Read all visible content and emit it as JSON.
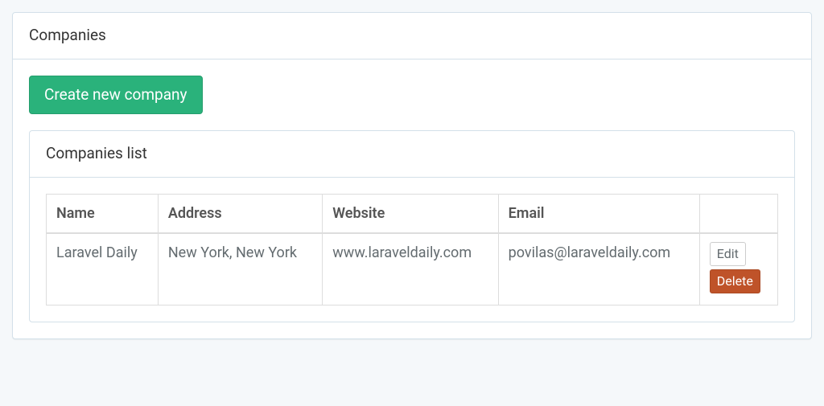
{
  "page": {
    "heading": "Companies",
    "create_button": "Create new company",
    "list_heading": "Companies list"
  },
  "table": {
    "headers": {
      "name": "Name",
      "address": "Address",
      "website": "Website",
      "email": "Email",
      "actions": ""
    },
    "rows": [
      {
        "name": "Laravel Daily",
        "address": "New York, New York",
        "website": "www.laraveldaily.com",
        "email": "povilas@laraveldaily.com"
      }
    ]
  },
  "actions": {
    "edit": "Edit",
    "delete": "Delete"
  }
}
